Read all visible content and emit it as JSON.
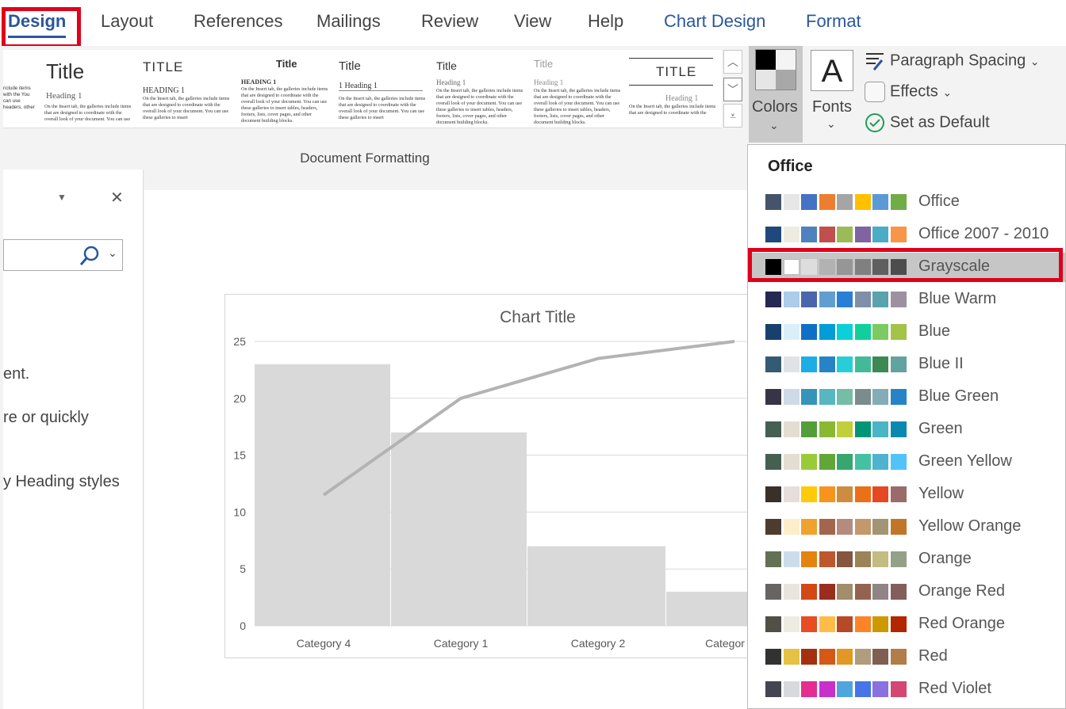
{
  "tabs": [
    {
      "label": "Design",
      "active": true
    },
    {
      "label": "Layout"
    },
    {
      "label": "References"
    },
    {
      "label": "Mailings"
    },
    {
      "label": "Review"
    },
    {
      "label": "View"
    },
    {
      "label": "Help"
    },
    {
      "label": "Chart Design",
      "contextual": true
    },
    {
      "label": "Format",
      "contextual": true
    }
  ],
  "gallery": {
    "styles": [
      {
        "title": "Title",
        "heading": "Heading 1",
        "body": "On the Insert tab, the galleries include items that are designed to coordinate with the overall look of your document. You can use"
      },
      {
        "title": "TITLE",
        "heading": "HEADING 1",
        "body": "On the Insert tab, the galleries include items that are designed to coordinate with the overall look of your document. You can use these galleries to insert"
      },
      {
        "title": "Title",
        "heading": "HEADING 1",
        "body": "On the Insert tab, the galleries include items that are designed to coordinate with the overall look of your document. You can use these galleries to insert tables, headers, footers, lists, cover pages, and other document building blocks."
      },
      {
        "title": "Title",
        "heading": "1  Heading 1",
        "body": "On the Insert tab, the galleries include items that are designed to coordinate with the overall look of your document. You can use these galleries to insert"
      },
      {
        "title": "Title",
        "heading": "Heading 1",
        "body": "On the Insert tab, the galleries include items that are designed to coordinate with the overall look of your document. You can use these galleries to insert tables, headers, footers, lists, cover pages, and other document building blocks."
      },
      {
        "title": "Title",
        "heading": "Heading 1",
        "body": "On the Insert tab, the galleries include items that are designed to coordinate with the overall look of your document. You can use these galleries to insert tables, headers, footers, lists, cover pages, and other document building blocks."
      },
      {
        "title": "TITLE",
        "heading": "Heading 1",
        "body": "On the Insert tab, the galleries include items that are designed to coordinate with the"
      }
    ],
    "partial_body": "nclude items with the You can use headers, other",
    "group_label": "Document Formatting"
  },
  "ribbon": {
    "colors_label": "Colors",
    "fonts_label": "Fonts",
    "fonts_glyph": "A",
    "paragraph_spacing": "Paragraph Spacing",
    "effects": "Effects",
    "set_default": "Set as Default"
  },
  "navpane": {
    "lines": [
      "ent.",
      "re or quickly",
      "y Heading styles"
    ]
  },
  "chart_data": {
    "type": "bar",
    "title": "Chart Title",
    "categories": [
      "Category 4",
      "Category 1",
      "Category 2",
      "Categor"
    ],
    "series": [
      {
        "type": "bar",
        "values": [
          23,
          17,
          7,
          3
        ]
      },
      {
        "type": "line",
        "values": [
          11.5,
          20,
          23.5,
          25
        ]
      }
    ],
    "ylim": [
      0,
      25
    ],
    "yticks": [
      0,
      5,
      10,
      15,
      20,
      25
    ],
    "bar_color": "#d9d9d9",
    "line_color": "#b3b3b3",
    "grid": true
  },
  "dropdown": {
    "header": "Office",
    "themes": [
      {
        "name": "Office",
        "colors": [
          "#44546a",
          "#e7e6e6",
          "#4472c4",
          "#ed7d31",
          "#a5a5a5",
          "#ffc000",
          "#5b9bd5",
          "#70ad47"
        ]
      },
      {
        "name": "Office 2007 - 2010",
        "colors": [
          "#1f497d",
          "#eeece1",
          "#4f81bd",
          "#c0504d",
          "#9bbb59",
          "#8064a2",
          "#4bacc6",
          "#f79646"
        ]
      },
      {
        "name": "Grayscale",
        "selected": true,
        "colors": [
          "#000000",
          "#ffffff",
          "#dddddd",
          "#b2b2b2",
          "#969696",
          "#808080",
          "#5f5f5f",
          "#4d4d4d"
        ]
      },
      {
        "name": "Blue Warm",
        "colors": [
          "#242852",
          "#acccea",
          "#4a66ac",
          "#629dd1",
          "#297fd5",
          "#7f8fa9",
          "#5aa2ae",
          "#9d90a0"
        ]
      },
      {
        "name": "Blue",
        "colors": [
          "#17406d",
          "#dbeff9",
          "#0f6fc6",
          "#009dd9",
          "#0bd0d9",
          "#10cf9b",
          "#7cca62",
          "#a5c249"
        ]
      },
      {
        "name": "Blue II",
        "colors": [
          "#335b74",
          "#dfe3e5",
          "#1cade4",
          "#2683c6",
          "#27ced7",
          "#42ba97",
          "#3e8853",
          "#62a39f"
        ]
      },
      {
        "name": "Blue Green",
        "colors": [
          "#373545",
          "#cedbe6",
          "#3494ba",
          "#58b6c0",
          "#75bda7",
          "#7a8c8e",
          "#84acb6",
          "#2683c6"
        ]
      },
      {
        "name": "Green",
        "colors": [
          "#455f51",
          "#e3ded1",
          "#549e39",
          "#8ab833",
          "#c0cf3a",
          "#029676",
          "#4ab5c4",
          "#0989b1"
        ]
      },
      {
        "name": "Green Yellow",
        "colors": [
          "#455f51",
          "#e3ded1",
          "#99cb38",
          "#63a537",
          "#37a76f",
          "#44c1a3",
          "#4eb3cf",
          "#51c3f9"
        ]
      },
      {
        "name": "Yellow",
        "colors": [
          "#39302a",
          "#e5dedb",
          "#ffca08",
          "#f8931d",
          "#ce8d3e",
          "#ec7016",
          "#e64823",
          "#9c6a6a"
        ]
      },
      {
        "name": "Yellow Orange",
        "colors": [
          "#4e3b30",
          "#fbeec9",
          "#f0a22e",
          "#a5644e",
          "#b58b80",
          "#c3986d",
          "#a19574",
          "#c17529"
        ]
      },
      {
        "name": "Orange",
        "colors": [
          "#637052",
          "#ccddea",
          "#e48312",
          "#bd582c",
          "#865640",
          "#9b8357",
          "#c2bc80",
          "#94a088"
        ]
      },
      {
        "name": "Orange Red",
        "colors": [
          "#696464",
          "#e9e5dc",
          "#d34817",
          "#9b2d1f",
          "#a28e6a",
          "#956251",
          "#918485",
          "#855d5d"
        ]
      },
      {
        "name": "Red Orange",
        "colors": [
          "#505046",
          "#eeece1",
          "#e84c22",
          "#ffbd47",
          "#b64926",
          "#ff8427",
          "#cc9900",
          "#b22600"
        ]
      },
      {
        "name": "Red",
        "colors": [
          "#323232",
          "#e5c243",
          "#a5300f",
          "#d55816",
          "#e19825",
          "#b19c7d",
          "#7f5f52",
          "#b27d49"
        ]
      },
      {
        "name": "Red Violet",
        "colors": [
          "#454551",
          "#d8d9dc",
          "#e32d91",
          "#c830cc",
          "#4ea6dc",
          "#4775e7",
          "#8971e1",
          "#d54773"
        ]
      }
    ]
  }
}
